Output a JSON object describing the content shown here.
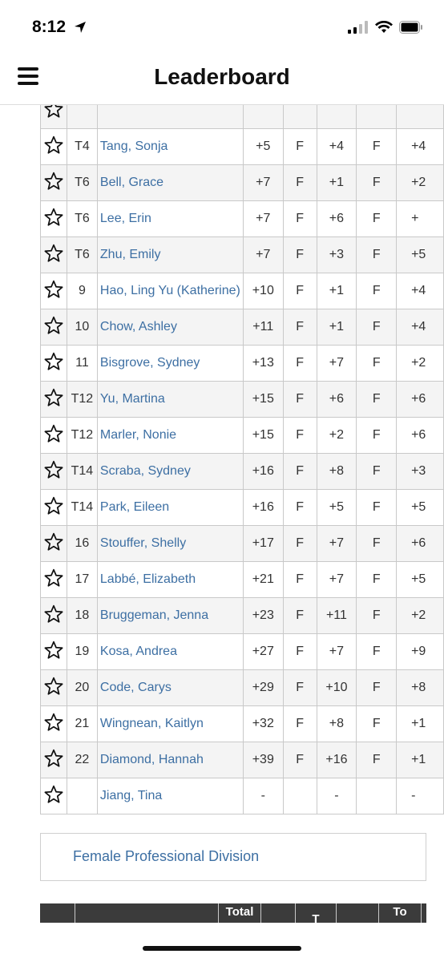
{
  "status_bar": {
    "time": "8:12"
  },
  "header": {
    "title": "Leaderboard"
  },
  "rows": [
    {
      "pos": "T4",
      "name": "Tang, Sonja",
      "total": "+5",
      "thru": "F",
      "today": "+4",
      "thru2": "F",
      "r": "+4"
    },
    {
      "pos": "T6",
      "name": "Bell, Grace",
      "total": "+7",
      "thru": "F",
      "today": "+1",
      "thru2": "F",
      "r": "+2"
    },
    {
      "pos": "T6",
      "name": "Lee, Erin",
      "total": "+7",
      "thru": "F",
      "today": "+6",
      "thru2": "F",
      "r": "+"
    },
    {
      "pos": "T6",
      "name": "Zhu, Emily",
      "total": "+7",
      "thru": "F",
      "today": "+3",
      "thru2": "F",
      "r": "+5"
    },
    {
      "pos": "9",
      "name": "Hao, Ling Yu (Katherine)",
      "total": "+10",
      "thru": "F",
      "today": "+1",
      "thru2": "F",
      "r": "+4"
    },
    {
      "pos": "10",
      "name": "Chow, Ashley",
      "total": "+11",
      "thru": "F",
      "today": "+1",
      "thru2": "F",
      "r": "+4"
    },
    {
      "pos": "11",
      "name": "Bisgrove, Sydney",
      "total": "+13",
      "thru": "F",
      "today": "+7",
      "thru2": "F",
      "r": "+2"
    },
    {
      "pos": "T12",
      "name": "Yu, Martina",
      "total": "+15",
      "thru": "F",
      "today": "+6",
      "thru2": "F",
      "r": "+6"
    },
    {
      "pos": "T12",
      "name": "Marler, Nonie",
      "total": "+15",
      "thru": "F",
      "today": "+2",
      "thru2": "F",
      "r": "+6"
    },
    {
      "pos": "T14",
      "name": "Scraba, Sydney",
      "total": "+16",
      "thru": "F",
      "today": "+8",
      "thru2": "F",
      "r": "+3"
    },
    {
      "pos": "T14",
      "name": "Park, Eileen",
      "total": "+16",
      "thru": "F",
      "today": "+5",
      "thru2": "F",
      "r": "+5"
    },
    {
      "pos": "16",
      "name": "Stouffer, Shelly",
      "total": "+17",
      "thru": "F",
      "today": "+7",
      "thru2": "F",
      "r": "+6"
    },
    {
      "pos": "17",
      "name": "Labbé, Elizabeth",
      "total": "+21",
      "thru": "F",
      "today": "+7",
      "thru2": "F",
      "r": "+5"
    },
    {
      "pos": "18",
      "name": "Bruggeman, Jenna",
      "total": "+23",
      "thru": "F",
      "today": "+11",
      "thru2": "F",
      "r": "+2"
    },
    {
      "pos": "19",
      "name": "Kosa, Andrea",
      "total": "+27",
      "thru": "F",
      "today": "+7",
      "thru2": "F",
      "r": "+9"
    },
    {
      "pos": "20",
      "name": "Code, Carys",
      "total": "+29",
      "thru": "F",
      "today": "+10",
      "thru2": "F",
      "r": "+8"
    },
    {
      "pos": "21",
      "name": "Wingnean, Kaitlyn",
      "total": "+32",
      "thru": "F",
      "today": "+8",
      "thru2": "F",
      "r": "+1"
    },
    {
      "pos": "22",
      "name": "Diamond, Hannah",
      "total": "+39",
      "thru": "F",
      "today": "+16",
      "thru2": "F",
      "r": "+1"
    },
    {
      "pos": "",
      "name": "Jiang, Tina",
      "total": "-",
      "thru": "",
      "today": "-",
      "thru2": "",
      "r": "-"
    }
  ],
  "division": {
    "label": "Female Professional Division"
  },
  "next_table_header": {
    "total": "Total",
    "t": "T",
    "to": "To"
  }
}
